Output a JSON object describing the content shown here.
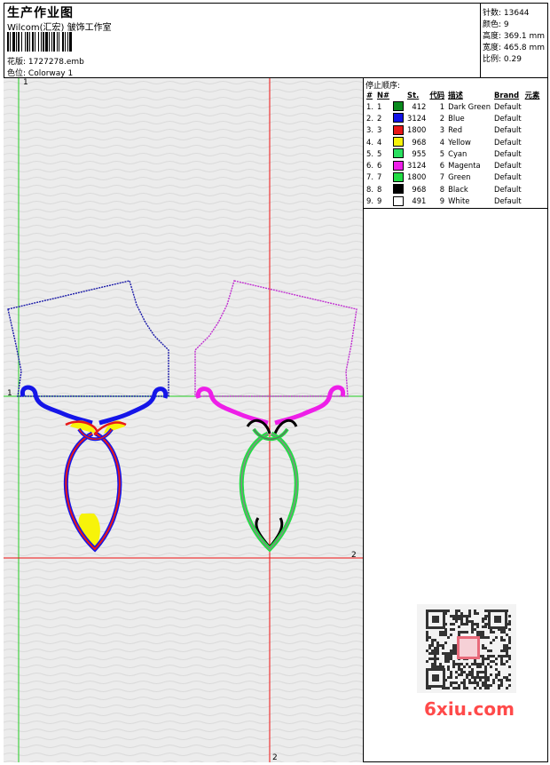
{
  "header": {
    "title": "生产作业图",
    "company": "Wilcom(汇宏) 皱饰工作室",
    "design_label": "花版:",
    "design_value": "1727278.emb",
    "colorway_label": "色位:",
    "colorway_value": "Colorway 1"
  },
  "stats": {
    "stitches": "针数: 13644",
    "colors": "颜色: 9",
    "height": "高度: 369.1 mm",
    "width": "宽度: 465.8 mm",
    "scale": "比例: 0.29"
  },
  "stop_sequence": {
    "title": "停止顺序:",
    "columns": [
      "#",
      "N#",
      "St.",
      "代码",
      "描述",
      "Brand",
      "元素"
    ],
    "rows": [
      {
        "idx": "1.",
        "n": "1",
        "color": "#0a8a1e",
        "st": "412",
        "code": "1",
        "desc": "Dark Green",
        "brand": "Default"
      },
      {
        "idx": "2.",
        "n": "2",
        "color": "#1212e6",
        "st": "3124",
        "code": "2",
        "desc": "Blue",
        "brand": "Default"
      },
      {
        "idx": "3.",
        "n": "3",
        "color": "#e81818",
        "st": "1800",
        "code": "3",
        "desc": "Red",
        "brand": "Default"
      },
      {
        "idx": "4.",
        "n": "4",
        "color": "#f7f30a",
        "st": "968",
        "code": "4",
        "desc": "Yellow",
        "brand": "Default"
      },
      {
        "idx": "5.",
        "n": "5",
        "color": "#2ae060",
        "st": "955",
        "code": "5",
        "desc": "Cyan",
        "brand": "Default"
      },
      {
        "idx": "6.",
        "n": "6",
        "color": "#ee1ee8",
        "st": "3124",
        "code": "6",
        "desc": "Magenta",
        "brand": "Default"
      },
      {
        "idx": "7.",
        "n": "7",
        "color": "#22dd44",
        "st": "1800",
        "code": "7",
        "desc": "Green",
        "brand": "Default"
      },
      {
        "idx": "8.",
        "n": "8",
        "color": "#000000",
        "st": "968",
        "code": "8",
        "desc": "Black",
        "brand": "Default"
      },
      {
        "idx": "9.",
        "n": "9",
        "color": "#ffffff",
        "st": "491",
        "code": "9",
        "desc": "White",
        "brand": "Default"
      }
    ]
  },
  "axis_labels": {
    "v1": "1",
    "h1": "1",
    "h2": "2",
    "v2": "2"
  },
  "watermark": "6xiu.com",
  "colors": {
    "canvas_bg": "#ececec",
    "guide_green": "#22cc22",
    "guide_red": "#ee1111",
    "blue_outline": "#1a1aa8",
    "magenta_outline": "#c030d0"
  }
}
